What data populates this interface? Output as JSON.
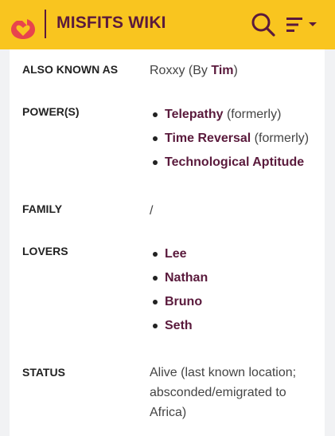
{
  "header": {
    "title": "MISFITS WIKI",
    "brand_color": "#f9c51f",
    "accent_color": "#5a1a3c",
    "logo_icon": "fandom-heart-logo-icon",
    "search_icon": "search-icon",
    "menu_icon": "hamburger-menu-icon"
  },
  "infobox": {
    "aka": {
      "label": "ALSO KNOWN AS",
      "prefix": "Roxxy (By ",
      "link": "Tim",
      "suffix": ")"
    },
    "powers": {
      "label": "POWER(S)",
      "items": [
        {
          "name": "Telepathy",
          "note": "(formerly)"
        },
        {
          "name": "Time Reversal",
          "note": "(formerly)"
        },
        {
          "name": "Technological Aptitude",
          "note": ""
        }
      ]
    },
    "family": {
      "label": "FAMILY",
      "value": "/"
    },
    "lovers": {
      "label": "LOVERS",
      "items": [
        "Lee",
        "Nathan",
        "Bruno",
        "Seth"
      ]
    },
    "status": {
      "label": "STATUS",
      "value": "Alive (last known location; absconded/emigrated to Africa)"
    }
  }
}
